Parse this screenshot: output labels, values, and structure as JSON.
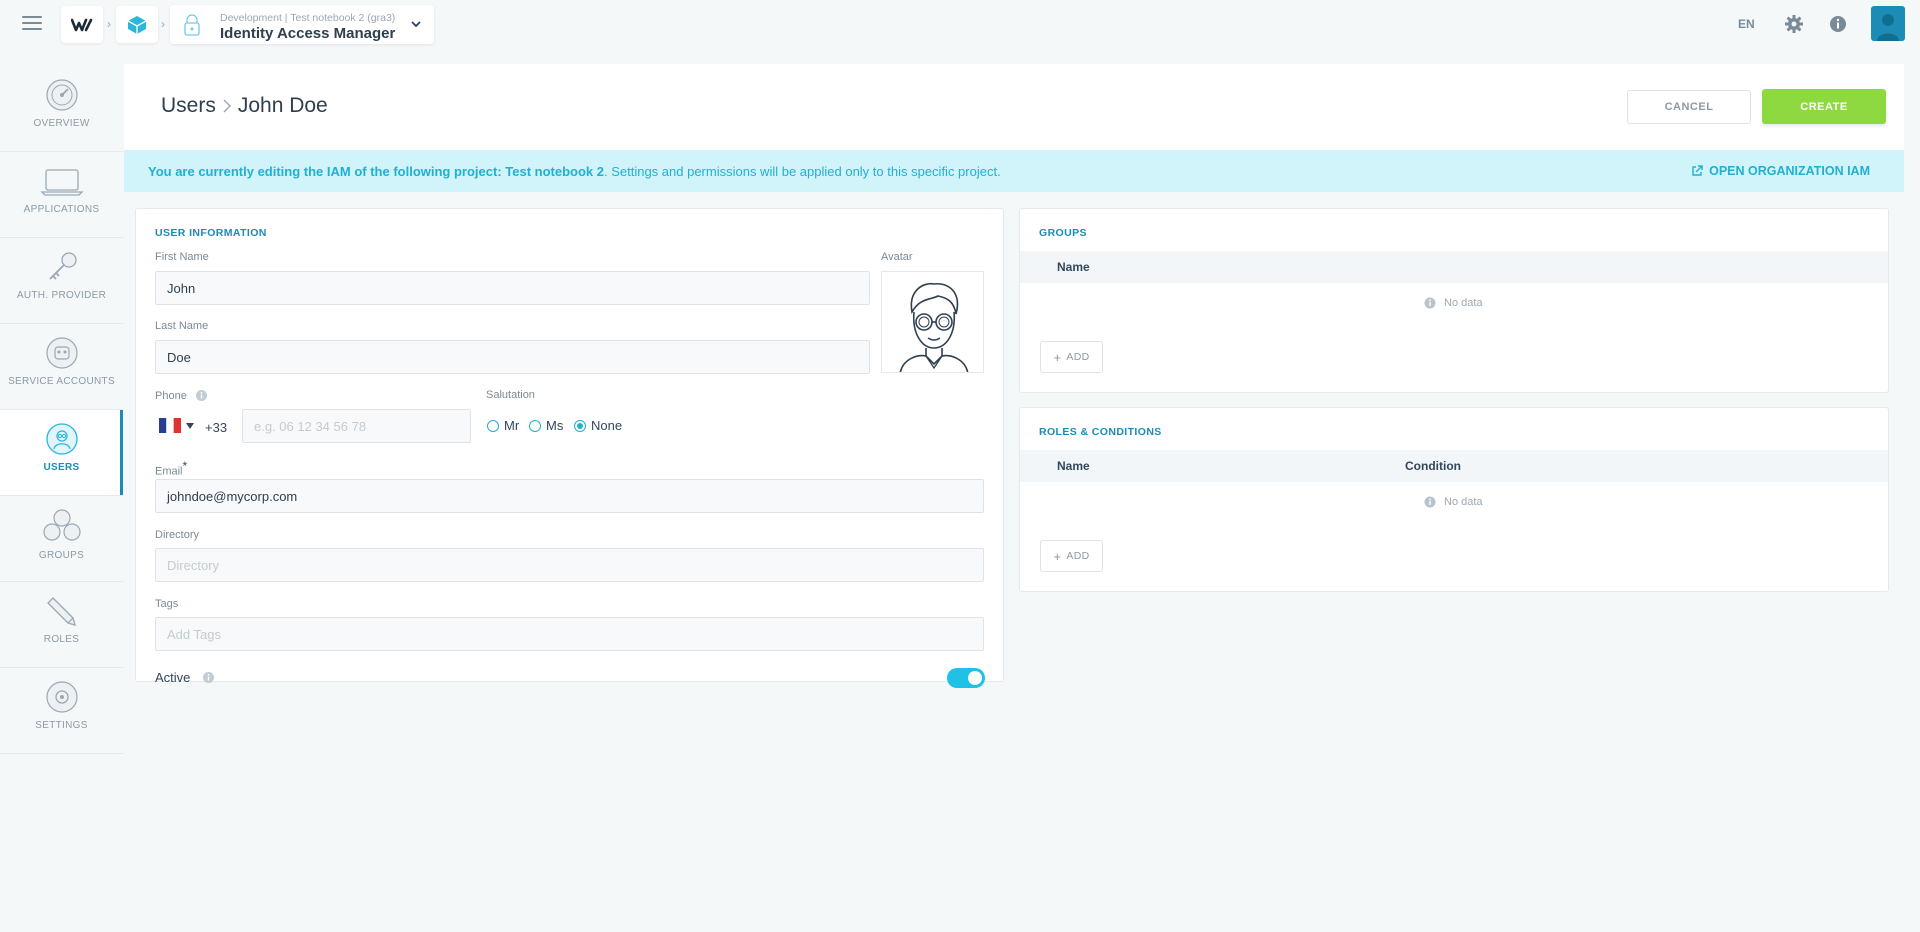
{
  "topbar": {
    "project_subtitle": "Development | Test notebook 2 (gra3)",
    "project_title": "Identity Access Manager",
    "language": "EN"
  },
  "sidebar": {
    "items": [
      {
        "label": "OVERVIEW",
        "icon": "gauge-icon"
      },
      {
        "label": "APPLICATIONS",
        "icon": "laptop-icon"
      },
      {
        "label": "AUTH. PROVIDER",
        "icon": "key-icon"
      },
      {
        "label": "SERVICE ACCOUNTS",
        "icon": "robot-icon"
      },
      {
        "label": "USERS",
        "icon": "user-icon"
      },
      {
        "label": "GROUPS",
        "icon": "group-icon"
      },
      {
        "label": "ROLES",
        "icon": "pencil-icon"
      },
      {
        "label": "SETTINGS",
        "icon": "settings-icon"
      }
    ],
    "active": "USERS"
  },
  "header": {
    "breadcrumb_root": "Users",
    "breadcrumb_current": "John Doe",
    "cancel_label": "CANCEL",
    "create_label": "CREATE"
  },
  "banner": {
    "message_bold": "You are currently editing the IAM of the following project: Test notebook 2",
    "message_rest": ". Settings and permissions will be applied only to this specific project.",
    "link_label": "OPEN ORGANIZATION IAM"
  },
  "user_info": {
    "title": "USER INFORMATION",
    "first_name_label": "First Name",
    "first_name_value": "John",
    "last_name_label": "Last Name",
    "last_name_value": "Doe",
    "avatar_label": "Avatar",
    "phone_label": "Phone",
    "phone_prefix": "+33",
    "phone_placeholder": "e.g. 06 12 34 56 78",
    "salutation_label": "Salutation",
    "salutation_options": [
      "Mr",
      "Ms",
      "None"
    ],
    "salutation_selected": "None",
    "email_label": "Email",
    "email_required_mark": "*",
    "email_value": "johndoe@mycorp.com",
    "directory_label": "Directory",
    "directory_placeholder": "Directory",
    "tags_label": "Tags",
    "tags_placeholder": "Add Tags",
    "active_label": "Active",
    "active_value": true
  },
  "groups": {
    "title": "GROUPS",
    "columns": [
      "Name"
    ],
    "empty_text": "No data",
    "add_label": "ADD"
  },
  "roles": {
    "title": "ROLES & CONDITIONS",
    "columns": [
      "Name",
      "Condition"
    ],
    "empty_text": "No data",
    "add_label": "ADD"
  },
  "colors": {
    "accent": "#1b8cb5",
    "banner_bg": "#d1f4fb",
    "banner_text": "#1fb0d2",
    "create_button": "#8fd940",
    "toggle_on": "#1fc1e6"
  }
}
